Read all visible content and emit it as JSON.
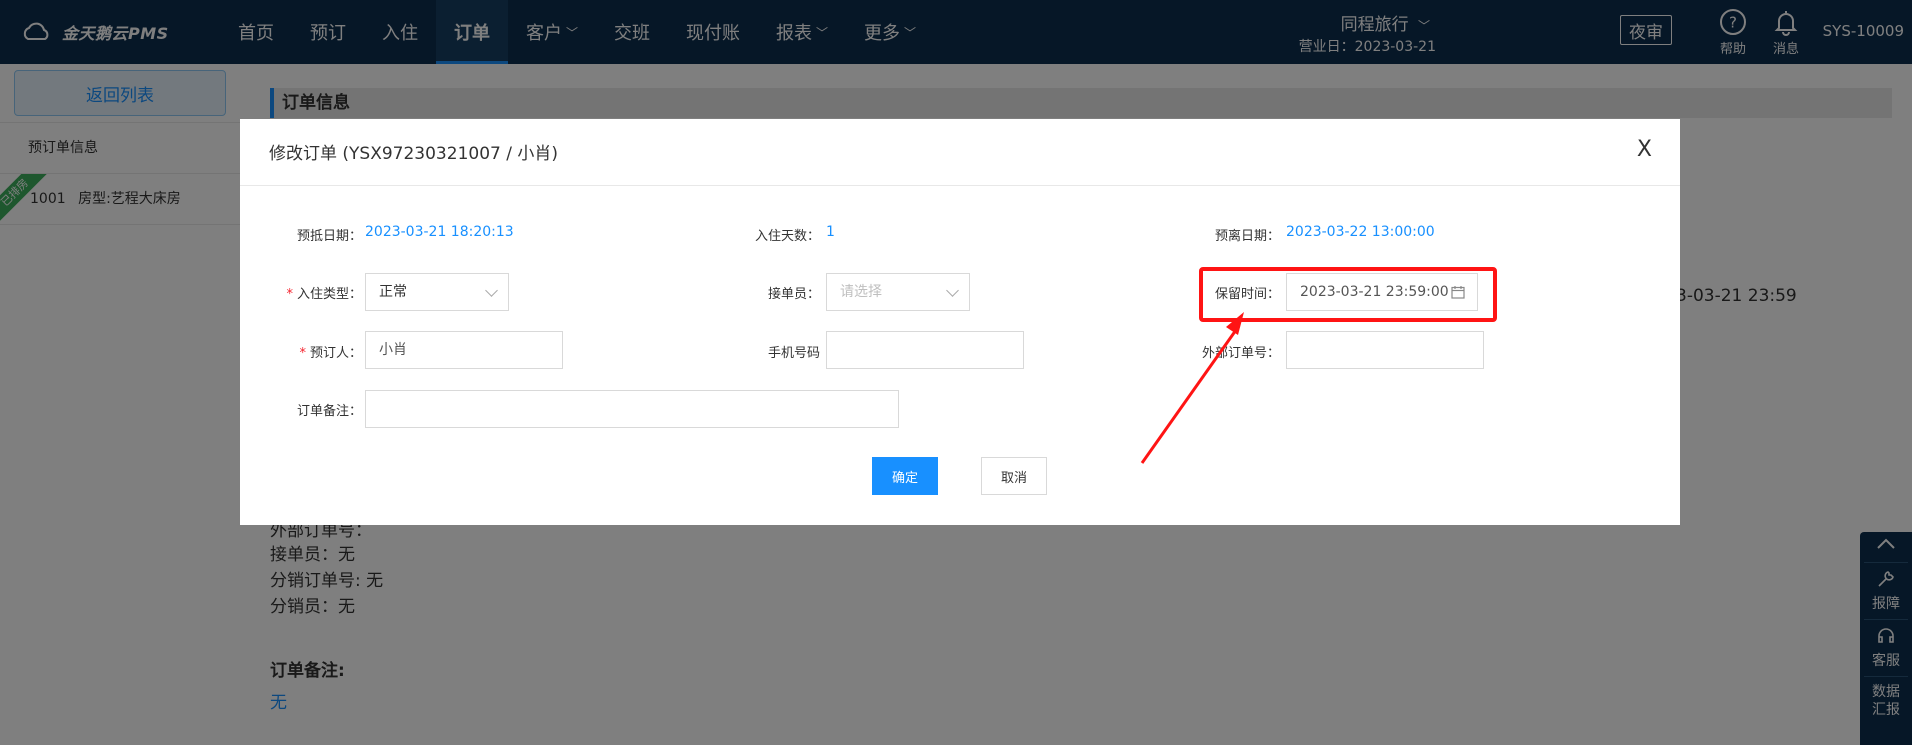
{
  "app": {
    "logo_text": "金天鹅云PMS",
    "nav": [
      {
        "label": "首页",
        "has_menu": false,
        "active": false
      },
      {
        "label": "预订",
        "has_menu": false,
        "active": false
      },
      {
        "label": "入住",
        "has_menu": false,
        "active": false
      },
      {
        "label": "订单",
        "has_menu": false,
        "active": true
      },
      {
        "label": "客户",
        "has_menu": true,
        "active": false
      },
      {
        "label": "交班",
        "has_menu": false,
        "active": false
      },
      {
        "label": "现付账",
        "has_menu": false,
        "active": false
      },
      {
        "label": "报表",
        "has_menu": true,
        "active": false
      },
      {
        "label": "更多",
        "has_menu": true,
        "active": false
      }
    ],
    "hotel_name": "同程旅行",
    "business_date": "营业日：2023-03-21",
    "night_audit_label": "夜审",
    "help_label": "帮助",
    "message_label": "消息",
    "user_id": "SYS-10009"
  },
  "sidebar": {
    "back_label": "返回列表",
    "section_title": "预订单信息",
    "room": {
      "status": "已排房",
      "number": "1001",
      "type": "房型:艺程大床房"
    }
  },
  "background": {
    "section_title": "订单信息",
    "retention_value_partial": "3-03-21 23:59",
    "ext_order_partial": "外部订单号：",
    "receiver_line": "接单员：无",
    "distribution_order_line": "分销订单号:   无",
    "distributor_line": "分销员：无",
    "order_note_label": "订单备注:",
    "order_note_value": "无"
  },
  "dialog": {
    "title": "修改订单 (YSX97230321007 / 小肖)",
    "close_label": "X",
    "arrive_date_label": "预抵日期：",
    "arrive_date_value": "2023-03-21 18:20:13",
    "stay_days_label": "入住天数：",
    "stay_days_value": "1",
    "leave_date_label": "预离日期：",
    "leave_date_value": "2023-03-22 13:00:00",
    "checkin_type_label": "入住类型：",
    "checkin_type_value": "正常",
    "receiver_label": "接单员：",
    "receiver_placeholder": "请选择",
    "retention_label": "保留时间：",
    "retention_value": "2023-03-21 23:59:00",
    "booker_label": "预订人：",
    "booker_value": "小肖",
    "phone_label": "手机号码",
    "phone_value": "",
    "ext_order_label": "外部订单号：",
    "ext_order_value": "",
    "note_label": "订单备注：",
    "note_value": "",
    "confirm_label": "确定",
    "cancel_label": "取消"
  },
  "float_tools": [
    "报障",
    "客服",
    "数据汇报"
  ],
  "colors": {
    "topbar": "#0d2f4f",
    "primary": "#1890ff",
    "annotation_red": "#ff1414",
    "required": "#f5222d",
    "room_badge": "#3cae5c"
  }
}
